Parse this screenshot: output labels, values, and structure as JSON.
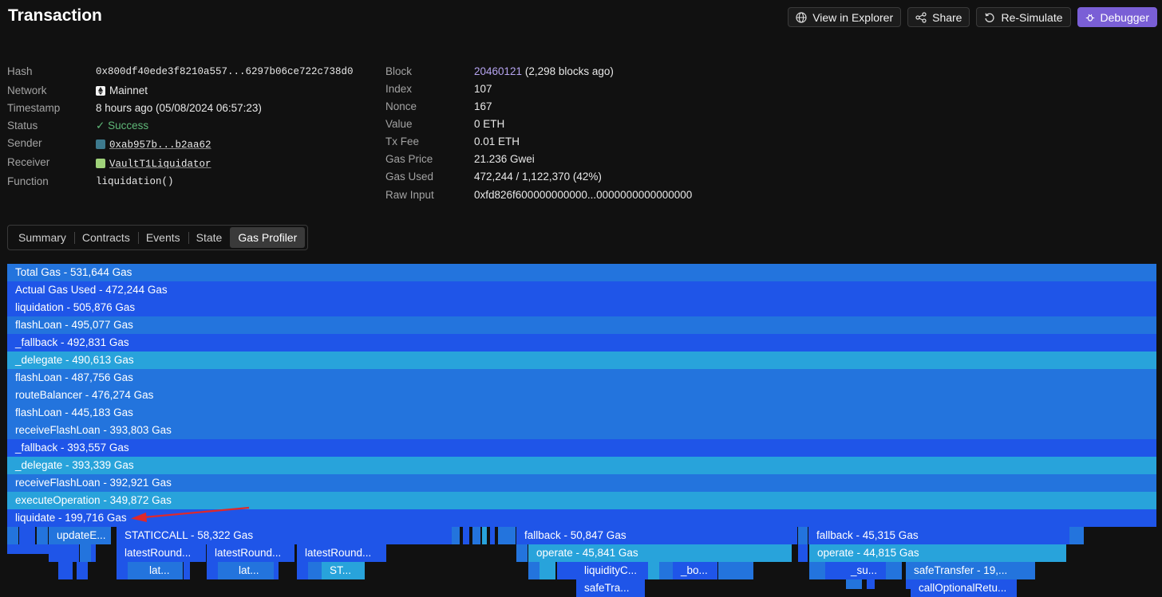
{
  "header": {
    "title": "Transaction",
    "buttons": {
      "explorer": "View in Explorer",
      "share": "Share",
      "resimulate": "Re-Simulate",
      "debugger": "Debugger"
    }
  },
  "details_left": {
    "hash": {
      "label": "Hash",
      "value": "0x800df40ede3f8210a557...6297b06ce722c738d0"
    },
    "network": {
      "label": "Network",
      "value": "Mainnet"
    },
    "timestamp": {
      "label": "Timestamp",
      "value": "8 hours ago (05/08/2024 06:57:23)"
    },
    "status": {
      "label": "Status",
      "value": "Success"
    },
    "sender": {
      "label": "Sender",
      "value": "0xab957b...b2aa62"
    },
    "receiver": {
      "label": "Receiver",
      "value": "VaultT1Liquidator"
    },
    "function": {
      "label": "Function",
      "value": "liquidation()"
    }
  },
  "details_right": {
    "block": {
      "label": "Block",
      "value": "20460121",
      "extra": "(2,298 blocks ago)"
    },
    "index": {
      "label": "Index",
      "value": "107"
    },
    "nonce": {
      "label": "Nonce",
      "value": "167"
    },
    "value": {
      "label": "Value",
      "value": "0 ETH"
    },
    "txfee": {
      "label": "Tx Fee",
      "value": "0.01 ETH"
    },
    "gasprice": {
      "label": "Gas Price",
      "value": "21.236 Gwei"
    },
    "gasused": {
      "label": "Gas Used",
      "value": "472,244 / 1,122,370 (42%)"
    },
    "rawinput": {
      "label": "Raw Input",
      "value": "0xfd826f600000000000...0000000000000000"
    }
  },
  "tabs": [
    "Summary",
    "Contracts",
    "Events",
    "State",
    "Gas Profiler"
  ],
  "active_tab": "Gas Profiler",
  "colors": {
    "bright": "#1f55e8",
    "medium": "#2374dd",
    "light": "#28a3db",
    "arrow": "#e0282a",
    "purple_button": "#7a5fd6",
    "success": "#5fb878"
  },
  "flame": {
    "main_frames": [
      {
        "label": "Total Gas - 531,644 Gas",
        "gas": 531644,
        "tone": "medium"
      },
      {
        "label": "Actual Gas Used - 472,244 Gas",
        "gas": 472244,
        "tone": "bright"
      },
      {
        "label": "liquidation - 505,876 Gas",
        "gas": 505876,
        "tone": "bright"
      },
      {
        "label": "flashLoan - 495,077 Gas",
        "gas": 495077,
        "tone": "medium"
      },
      {
        "label": "_fallback - 492,831 Gas",
        "gas": 492831,
        "tone": "bright"
      },
      {
        "label": "_delegate - 490,613 Gas",
        "gas": 490613,
        "tone": "light"
      },
      {
        "label": "flashLoan - 487,756 Gas",
        "gas": 487756,
        "tone": "medium"
      },
      {
        "label": "routeBalancer - 476,274 Gas",
        "gas": 476274,
        "tone": "medium"
      },
      {
        "label": "flashLoan - 445,183 Gas",
        "gas": 445183,
        "tone": "medium"
      },
      {
        "label": "receiveFlashLoan - 393,803 Gas",
        "gas": 393803,
        "tone": "medium"
      },
      {
        "label": "_fallback - 393,557 Gas",
        "gas": 393557,
        "tone": "bright"
      },
      {
        "label": "_delegate - 393,339 Gas",
        "gas": 393339,
        "tone": "light"
      },
      {
        "label": "receiveFlashLoan - 392,921 Gas",
        "gas": 392921,
        "tone": "medium"
      },
      {
        "label": "executeOperation - 349,872 Gas",
        "gas": 349872,
        "tone": "light"
      },
      {
        "label": "liquidate - 199,716 Gas",
        "gas": 199716,
        "tone": "bright"
      }
    ],
    "child_frames": [
      {
        "label": "updateE...",
        "tone": "medium"
      },
      {
        "label": "STATICCALL - 58,322 Gas",
        "tone": "bright"
      },
      {
        "label": "fallback - 50,847 Gas",
        "tone": "bright"
      },
      {
        "label": "fallback - 45,315 Gas",
        "tone": "bright"
      },
      {
        "label": "latestRound...",
        "tone": "bright"
      },
      {
        "label": "latestRound...",
        "tone": "bright"
      },
      {
        "label": "latestRound...",
        "tone": "bright"
      },
      {
        "label": "operate - 45,841 Gas",
        "tone": "light"
      },
      {
        "label": "operate - 44,815 Gas",
        "tone": "light"
      },
      {
        "label": "lat...",
        "tone": "medium"
      },
      {
        "label": "lat...",
        "tone": "medium"
      },
      {
        "label": "ST...",
        "tone": "light"
      },
      {
        "label": "liquidityC...",
        "tone": "bright"
      },
      {
        "label": "_bo...",
        "tone": "bright"
      },
      {
        "label": "_su...",
        "tone": "bright"
      },
      {
        "label": "safeTransfer - 19,...",
        "tone": "medium"
      },
      {
        "label": "safeTra...",
        "tone": "bright"
      },
      {
        "label": "callOptionalRetu...",
        "tone": "bright"
      }
    ]
  }
}
